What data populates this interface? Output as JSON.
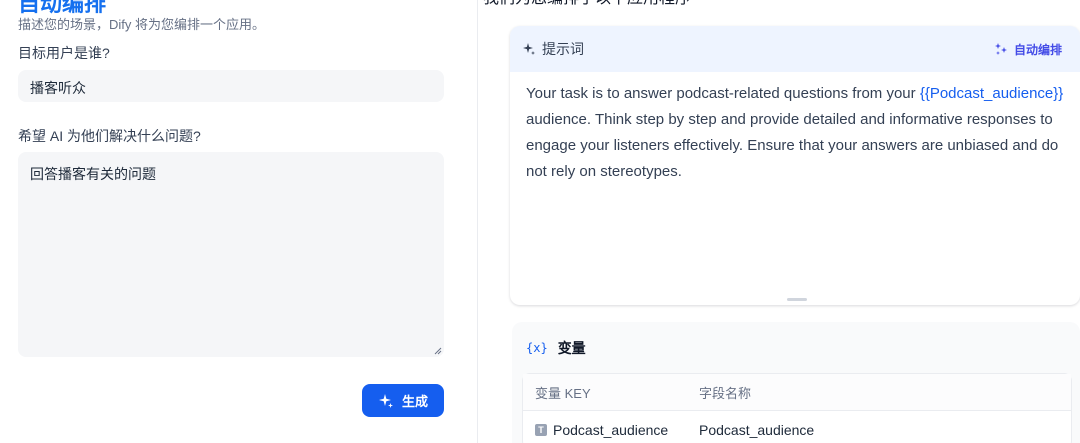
{
  "left": {
    "title": "自动编排",
    "description": "描述您的场景，Dify 将为您编排一个应用。",
    "target_user_label": "目标用户是谁?",
    "target_user_value": "播客听众",
    "problem_label": "希望 AI 为他们解决什么问题?",
    "problem_value": "回答播客有关的问题",
    "generate_button": "生成"
  },
  "right": {
    "heading": "我们为您编排了以下应用程序",
    "prompt": {
      "title": "提示词",
      "auto_arrange": "自动编排",
      "text_before": "Your task is to answer podcast-related questions from your ",
      "variable": "{{Podcast_audience}}",
      "text_after": " audience. Think step by step and provide detailed and informative responses to engage your listeners effectively. Ensure that your answers are unbiased and do not rely on stereotypes."
    },
    "variables": {
      "title": "变量",
      "columns": [
        "变量 KEY",
        "字段名称"
      ],
      "rows": [
        {
          "key": "Podcast_audience",
          "name": "Podcast_audience",
          "type_icon": "T"
        }
      ]
    }
  },
  "colors": {
    "primary": "#155eef",
    "accent": "#444ce7",
    "prompt_header_bg": "#eef4ff"
  }
}
